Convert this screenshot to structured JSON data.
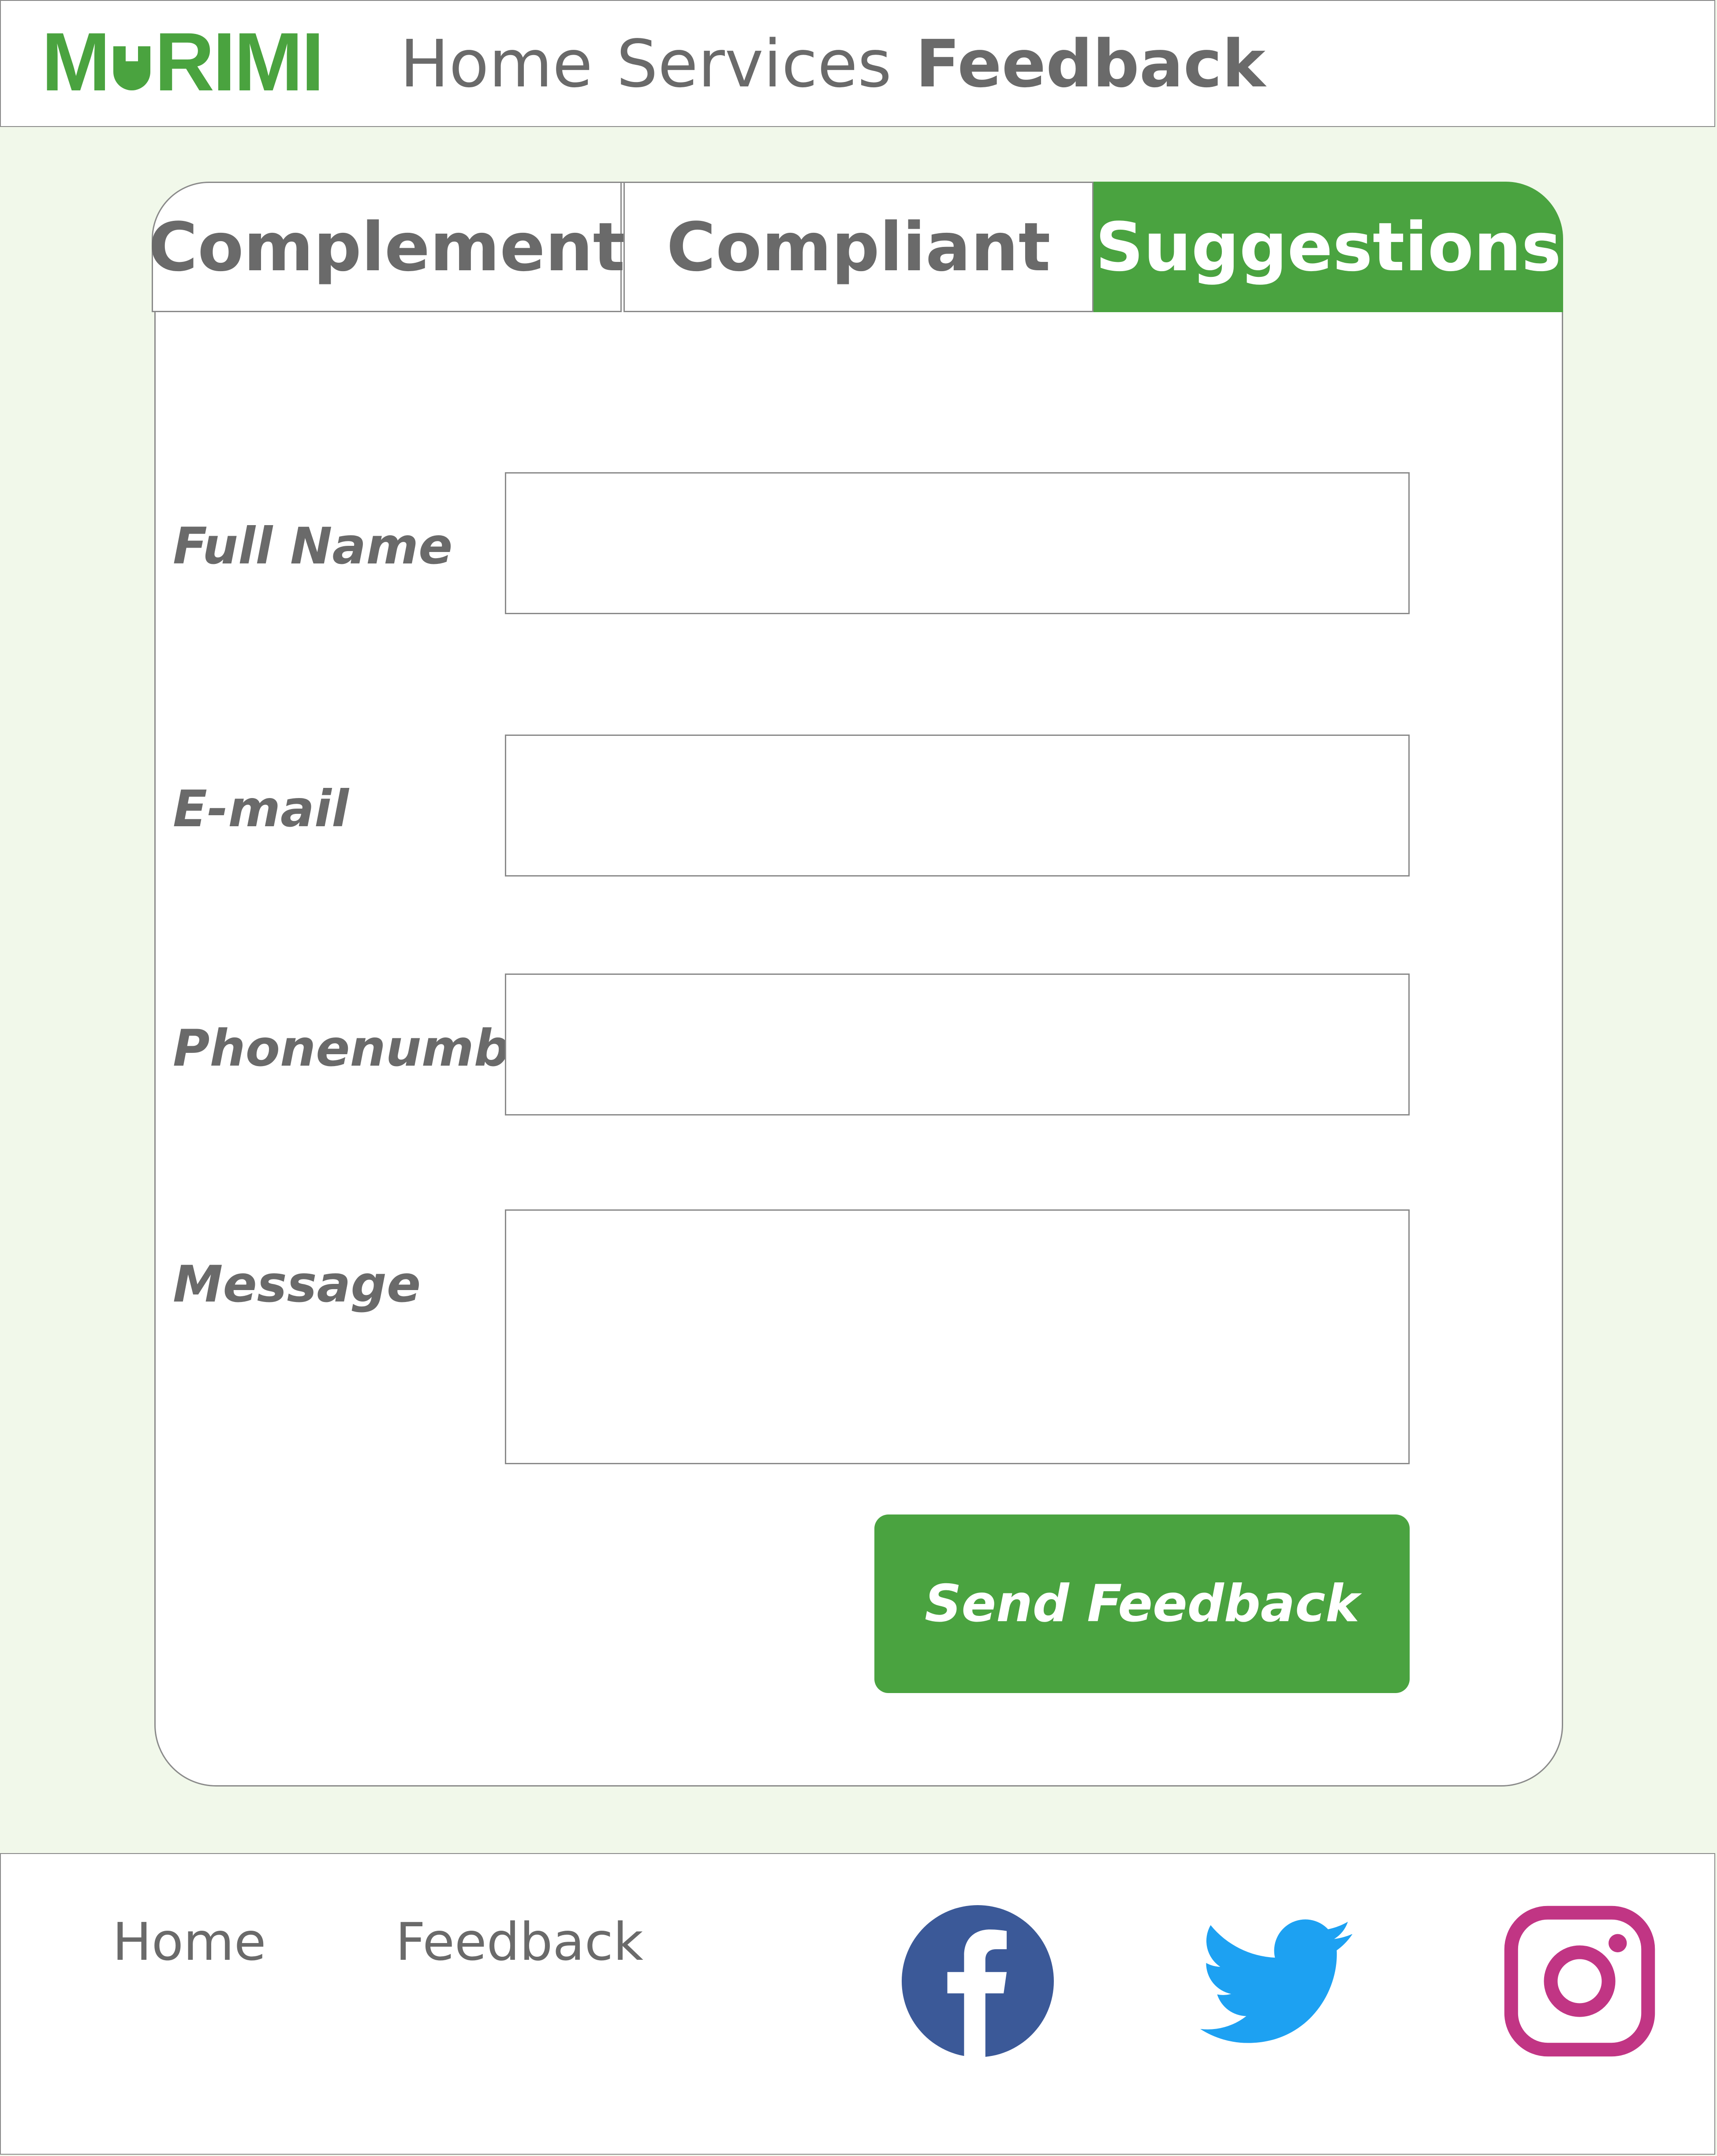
{
  "brand": {
    "logo_left": "M",
    "logo_right": "RIMI",
    "color": "#4aa33f"
  },
  "nav": {
    "items": [
      {
        "label": "Home",
        "active": false
      },
      {
        "label": "Services",
        "active": false
      },
      {
        "label": "Feedback",
        "active": true
      }
    ]
  },
  "tabs": [
    {
      "label": "Complement",
      "active": false
    },
    {
      "label": "Compliant",
      "active": false
    },
    {
      "label": "Suggestions",
      "active": true
    }
  ],
  "form": {
    "full_name": {
      "label": "Full Name",
      "value": ""
    },
    "email": {
      "label": "E-mail",
      "value": ""
    },
    "phone": {
      "label": "Phonenumber",
      "value": ""
    },
    "message": {
      "label": "Message",
      "value": ""
    },
    "submit_label": "Send Feedback"
  },
  "footer": {
    "links": [
      {
        "label": "Home"
      },
      {
        "label": "Feedback"
      }
    ],
    "social": [
      {
        "icon": "facebook-icon",
        "color": "#3b5998"
      },
      {
        "icon": "twitter-icon",
        "color": "#1da1f2"
      },
      {
        "icon": "instagram-icon",
        "color": "#c13584"
      }
    ]
  },
  "colors": {
    "accent": "#4aa340",
    "background": "#f1f8ea",
    "text": "#6a6a6a"
  }
}
